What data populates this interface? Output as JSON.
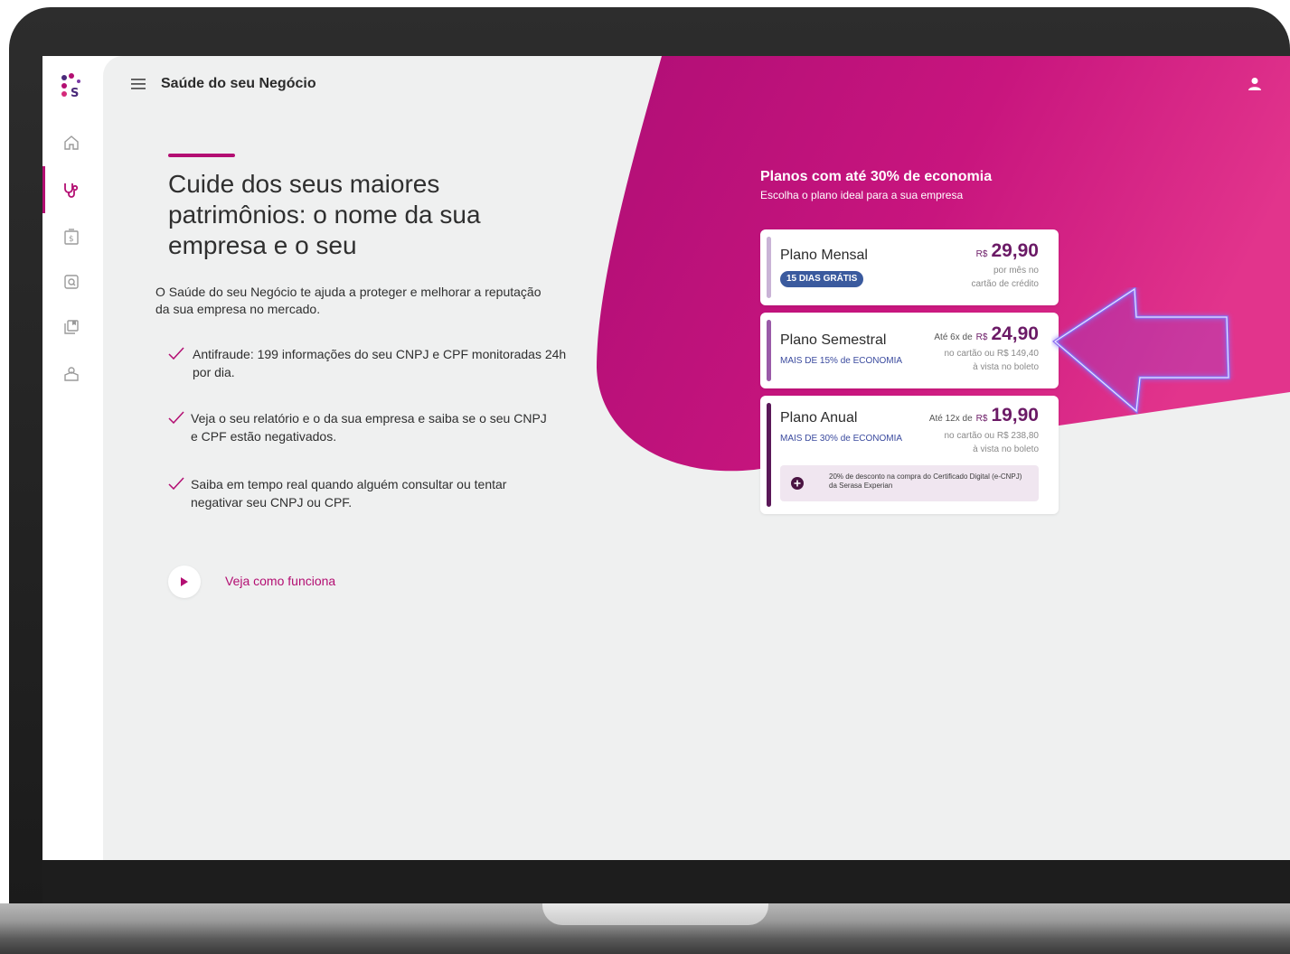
{
  "app": {
    "title": "Saúde do seu Negócio"
  },
  "nav": {
    "items": [
      {
        "icon": "home-icon"
      },
      {
        "icon": "stethoscope-icon",
        "active": true
      },
      {
        "icon": "money-icon"
      },
      {
        "icon": "search-document-icon"
      },
      {
        "icon": "copy-icon"
      },
      {
        "icon": "consumer-icon"
      }
    ]
  },
  "hero": {
    "headline": "Cuide dos seus maiores patrimônios: o nome da sua empresa e o seu",
    "intro": "O Saúde do seu Negócio te ajuda a proteger e melhorar a reputação da sua empresa no mercado.",
    "benefits": [
      "Antifraude: 199 informações do seu CNPJ e CPF monitoradas 24h por dia.",
      "Veja o seu relatório e o da sua empresa e saiba se o seu CNPJ e CPF estão negativados.",
      "Saiba em tempo real quando alguém consultar ou tentar negativar seu CNPJ ou CPF."
    ],
    "video_link": "Veja como funciona"
  },
  "plans": {
    "heading": "Planos com até 30% de economia",
    "subheading": "Escolha o plano ideal para a sua empresa",
    "items": [
      {
        "name": "Plano Mensal",
        "badge": "15 DIAS GRÁTIS",
        "prefix": "",
        "currency": "R$",
        "price": "29,90",
        "note_1": "por mês no",
        "note_2": "cartão de crédito"
      },
      {
        "name": "Plano Semestral",
        "economy": "MAIS DE 15% de ECONOMIA",
        "prefix": "Até 6x de",
        "currency": "R$",
        "price": "24,90",
        "note_1": "no cartão ou R$ 149,40",
        "note_2": "à vista no boleto"
      },
      {
        "name": "Plano Anual",
        "economy": "MAIS DE 30% de ECONOMIA",
        "prefix": "Até 12x de",
        "currency": "R$",
        "price": "19,90",
        "note_1": "no cartão ou R$ 238,80",
        "note_2": "à vista no boleto",
        "perk": "20% de desconto na compra do Certificado Digital (e-CNPJ) da Serasa Experian"
      }
    ]
  },
  "colors": {
    "brand": "#b30e72",
    "pink_light": "#dc2f8a",
    "purple_dark": "#6b1a66",
    "badge_blue": "#3a5a9e",
    "background": "#eff0f0"
  }
}
